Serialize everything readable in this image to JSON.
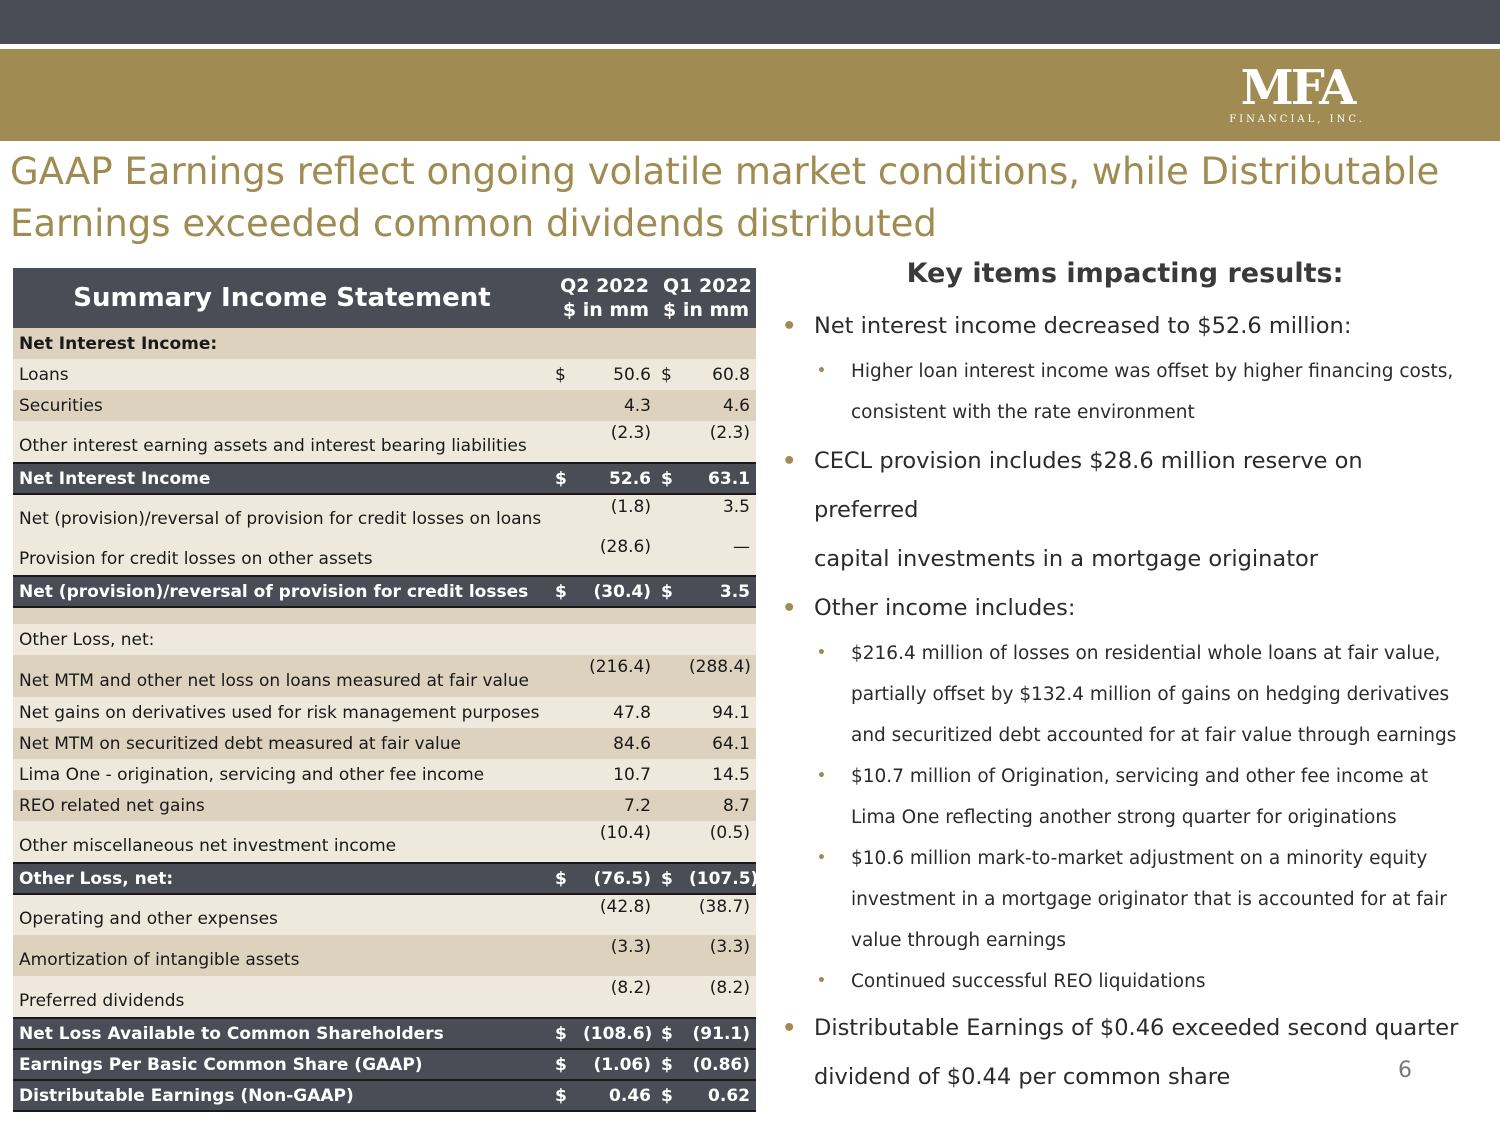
{
  "logo": {
    "main": "MFA",
    "sub": "FINANCIAL, INC."
  },
  "title": {
    "line1": "GAAP Earnings reflect ongoing volatile market conditions, while Distributable",
    "line2": "Earnings exceeded common dividends distributed"
  },
  "table": {
    "header": {
      "title": "Summary Income Statement",
      "col1a": "Q2 2022",
      "col1b": "$ in mm",
      "col2a": "Q1 2022",
      "col2b": "$ in mm"
    },
    "rows": [
      {
        "label": "Net Interest Income:",
        "c1": "",
        "v1": "",
        "c2": "",
        "v2": ""
      },
      {
        "label": "Loans",
        "c1": "$",
        "v1": "50.6",
        "c2": "$",
        "v2": "60.8"
      },
      {
        "label": "Securities",
        "c1": "",
        "v1": "4.3",
        "c2": "",
        "v2": "4.6"
      },
      {
        "label": "Other interest earning assets and interest bearing liabilities",
        "c1": "",
        "v1": "(2.3)",
        "c2": "",
        "v2": "(2.3)"
      },
      {
        "label": "Net Interest Income",
        "c1": "$",
        "v1": "52.6",
        "c2": "$",
        "v2": "63.1"
      },
      {
        "label": "Net (provision)/reversal of provision for credit losses on loans",
        "c1": "",
        "v1": "(1.8)",
        "c2": "",
        "v2": "3.5"
      },
      {
        "label": "Provision for credit losses on other assets",
        "c1": "",
        "v1": "(28.6)",
        "c2": "",
        "v2": "—"
      },
      {
        "label": "Net (provision)/reversal of provision for credit  losses",
        "c1": "$",
        "v1": "(30.4)",
        "c2": "$",
        "v2": "3.5"
      },
      {
        "label": "",
        "c1": "",
        "v1": "",
        "c2": "",
        "v2": ""
      },
      {
        "label": "Other Loss, net:",
        "c1": "",
        "v1": "",
        "c2": "",
        "v2": ""
      },
      {
        "label": "Net MTM and other net loss on loans measured at fair value",
        "c1": "",
        "v1": "(216.4)",
        "c2": "",
        "v2": "(288.4)"
      },
      {
        "label": "Net gains on derivatives used for risk management purposes",
        "c1": "",
        "v1": "47.8",
        "c2": "",
        "v2": "94.1"
      },
      {
        "label": "Net MTM on securitized debt measured at fair value",
        "c1": "",
        "v1": "84.6",
        "c2": "",
        "v2": "64.1"
      },
      {
        "label": "Lima One - origination, servicing and other fee income",
        "c1": "",
        "v1": "10.7",
        "c2": "",
        "v2": "14.5"
      },
      {
        "label": "REO related net gains",
        "c1": "",
        "v1": "7.2",
        "c2": "",
        "v2": "8.7"
      },
      {
        "label": "Other miscellaneous net investment income",
        "c1": "",
        "v1": "(10.4)",
        "c2": "",
        "v2": "(0.5)"
      },
      {
        "label": "Other Loss, net:",
        "c1": "$",
        "v1": "(76.5)",
        "c2": "$",
        "v2": "(107.5)"
      },
      {
        "label": "Operating and other expenses",
        "c1": "",
        "v1": "(42.8)",
        "c2": "",
        "v2": "(38.7)"
      },
      {
        "label": "Amortization of intangible assets",
        "c1": "",
        "v1": "(3.3)",
        "c2": "",
        "v2": "(3.3)"
      },
      {
        "label": "Preferred dividends",
        "c1": "",
        "v1": "(8.2)",
        "c2": "",
        "v2": "(8.2)"
      },
      {
        "label": "Net Loss Available to Common Shareholders",
        "c1": "$",
        "v1": "(108.6)",
        "c2": "$",
        "v2": "(91.1)"
      },
      {
        "label": "Earnings Per Basic Common Share (GAAP)",
        "c1": "$",
        "v1": "(1.06)",
        "c2": "$",
        "v2": "(0.86)"
      },
      {
        "label": "Distributable Earnings (Non-GAAP)",
        "c1": "$",
        "v1": "0.46",
        "c2": "$",
        "v2": "0.62"
      }
    ]
  },
  "key_items": {
    "heading": "Key items impacting results:",
    "b1": "Net interest income decreased to $52.6 million:",
    "b1a": "Higher loan interest income was offset by higher financing costs,",
    "b1b": "consistent with the rate environment",
    "b2a": "CECL provision includes $28.6 million reserve on preferred",
    "b2b": "capital investments in a mortgage originator",
    "b3": "Other income includes:",
    "b3a1": "$216.4 million of losses on residential whole loans at fair value,",
    "b3a2": "partially offset by $132.4 million of gains on hedging derivatives",
    "b3a3": "and securitized debt accounted for at fair value through earnings",
    "b3b1": "$10.7 million of Origination, servicing and other fee income at",
    "b3b2": "Lima One reflecting another strong quarter for originations",
    "b3c1": "$10.6 million mark-to-market adjustment on a minority equity",
    "b3c2": "investment in a mortgage originator that is accounted for at fair",
    "b3c3": "value through earnings",
    "b3d": "Continued successful REO liquidations",
    "b4a": "Distributable Earnings of $0.46 exceeded second quarter",
    "b4b": "dividend of $0.44 per common share"
  },
  "page_number": "6"
}
